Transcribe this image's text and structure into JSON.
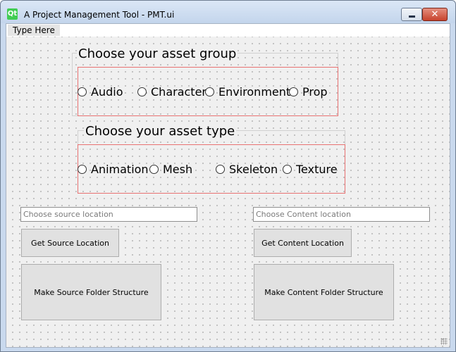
{
  "window": {
    "title": "A Project Management Tool - PMT.ui",
    "icon_label": "Qt",
    "minimize_icon": "minimize-icon",
    "close_icon": "close-icon"
  },
  "menubar": {
    "items": [
      "Type Here"
    ]
  },
  "asset_group": {
    "title": "Choose your asset group",
    "options": [
      "Audio",
      "Character",
      "Environment",
      "Prop"
    ]
  },
  "asset_type": {
    "title": "Choose your asset type",
    "options": [
      "Animation",
      "Mesh",
      "Skeleton",
      "Texture"
    ]
  },
  "source": {
    "placeholder": "Choose source location",
    "get_button": "Get Source Location",
    "make_button": "Make Source Folder Structure"
  },
  "content": {
    "placeholder": "Choose Content location",
    "get_button": "Get Content Location",
    "make_button": "Make Content Folder Structure"
  }
}
